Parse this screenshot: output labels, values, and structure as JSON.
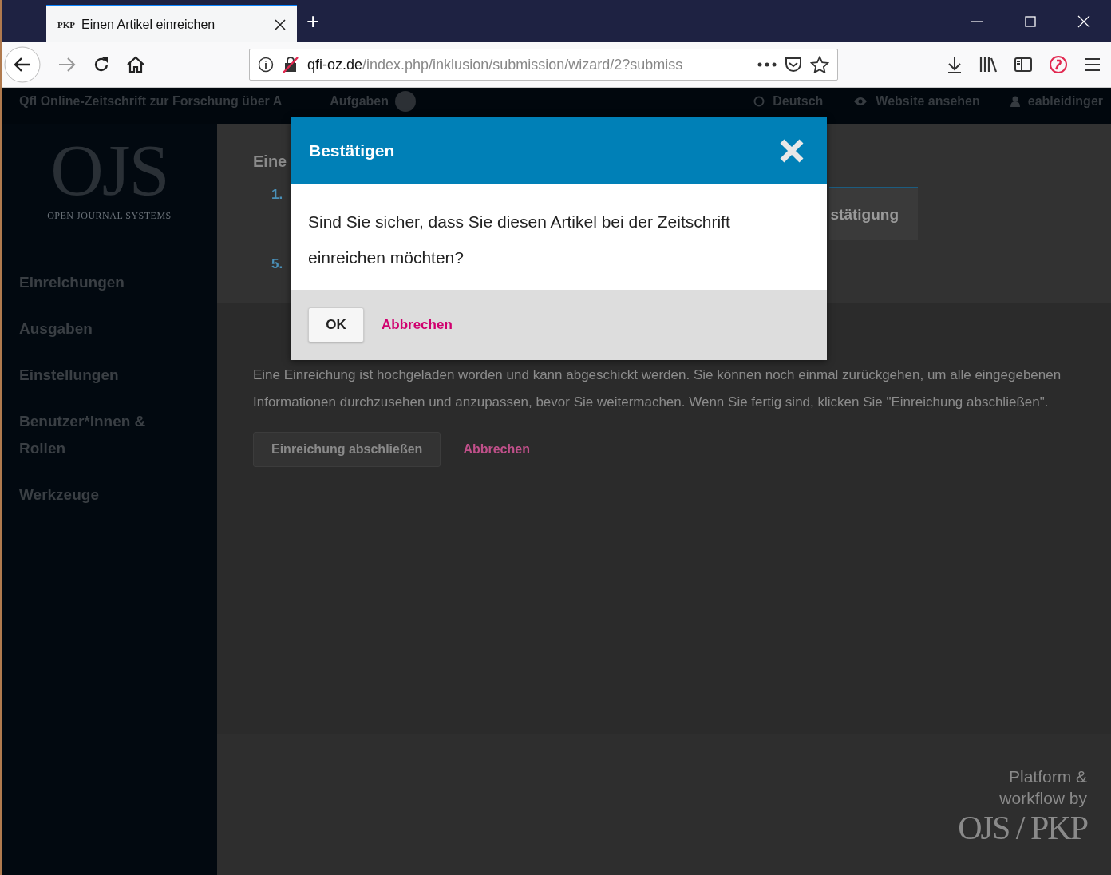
{
  "browser": {
    "tab_favicon": "PKP",
    "tab_title": "Einen Artikel einreichen",
    "new_tab": "+",
    "url_host": "qfi-oz.de",
    "url_path": "/index.php/inklusion/submission/wizard/2?submiss"
  },
  "top_bar": {
    "journal_title": "Qfl Online-Zeitschrift zur Forschung über A",
    "tasks_label": "Aufgaben",
    "language": "Deutsch",
    "view_site": "Website ansehen",
    "user": "eableidinger"
  },
  "sidebar": {
    "logo": "OJS",
    "logo_subtitle": "OPEN JOURNAL SYSTEMS",
    "items": [
      {
        "label": "Einreichungen"
      },
      {
        "label": "Ausgaben"
      },
      {
        "label": "Einstellungen"
      },
      {
        "label": "Benutzer*innen & Rollen"
      },
      {
        "label": "Werkzeuge"
      }
    ]
  },
  "page": {
    "heading": "Eine",
    "steps": [
      {
        "label": "1.",
        "selected": false
      },
      {
        "label": "stätigung",
        "selected": true
      },
      {
        "label": "5.",
        "selected": false
      }
    ],
    "description": "Eine Einreichung ist hochgeladen worden und kann abgeschickt werden. Sie können noch einmal zurückgehen, um alle eingegebenen Informationen durchzusehen und anzupassen, bevor Sie weitermachen. Wenn Sie fertig sind, klicken Sie \"Einreichung abschließen\".",
    "submit_button": "Einreichung abschließen",
    "cancel_link": "Abbrechen"
  },
  "footer": {
    "text": "Platform & workflow by",
    "logo": "OJS / PKP"
  },
  "dialog": {
    "title": "Bestätigen",
    "message": "Sind Sie sicher, dass Sie diesen Artikel bei der Zeitschrift einreichen möchten?",
    "ok_button": "OK",
    "cancel_link": "Abbrechen"
  }
}
